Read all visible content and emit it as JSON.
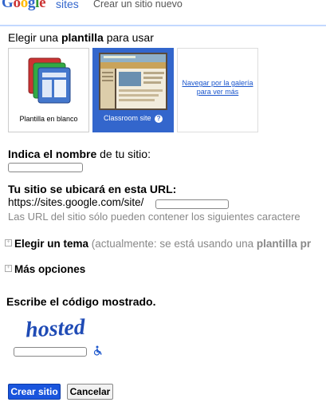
{
  "header": {
    "logo_text": "Google",
    "product": "sites",
    "subtitle": "Crear un sitio nuevo"
  },
  "template_section": {
    "heading_pre": "Elegir una ",
    "heading_bold": "plantilla",
    "heading_post": " para usar",
    "templates": [
      {
        "label": "Plantilla en blanco",
        "selected": false
      },
      {
        "label": "Classroom site",
        "selected": true,
        "help": "?"
      },
      {
        "link_line1": "Navegar por la galería",
        "link_line2": "para ver más"
      }
    ]
  },
  "name_section": {
    "label_bold": "Indica el nombre",
    "label_rest": " de tu sitio:",
    "value": ""
  },
  "url_section": {
    "label": "Tu sitio se ubicará en esta URL:",
    "prefix": "https://sites.google.com/site/",
    "value": "",
    "note": "Las URL del sitio sólo pueden contener los siguientes caractere"
  },
  "theme_section": {
    "label_bold": "Elegir un tema",
    "label_gray": " (actualmente: se está usando una ",
    "label_bold2": "plantilla pr"
  },
  "more_options": {
    "label": "Más opciones"
  },
  "captcha": {
    "label": "Escribe el código mostrado.",
    "word": "hosted",
    "value": ""
  },
  "buttons": {
    "create": "Crear sitio",
    "cancel": "Cancelar"
  },
  "colors": {
    "link": "#1a55cc",
    "primary": "#1a55dd",
    "selected_tile": "#3366cc",
    "header_rule": "#c3d9ff"
  }
}
